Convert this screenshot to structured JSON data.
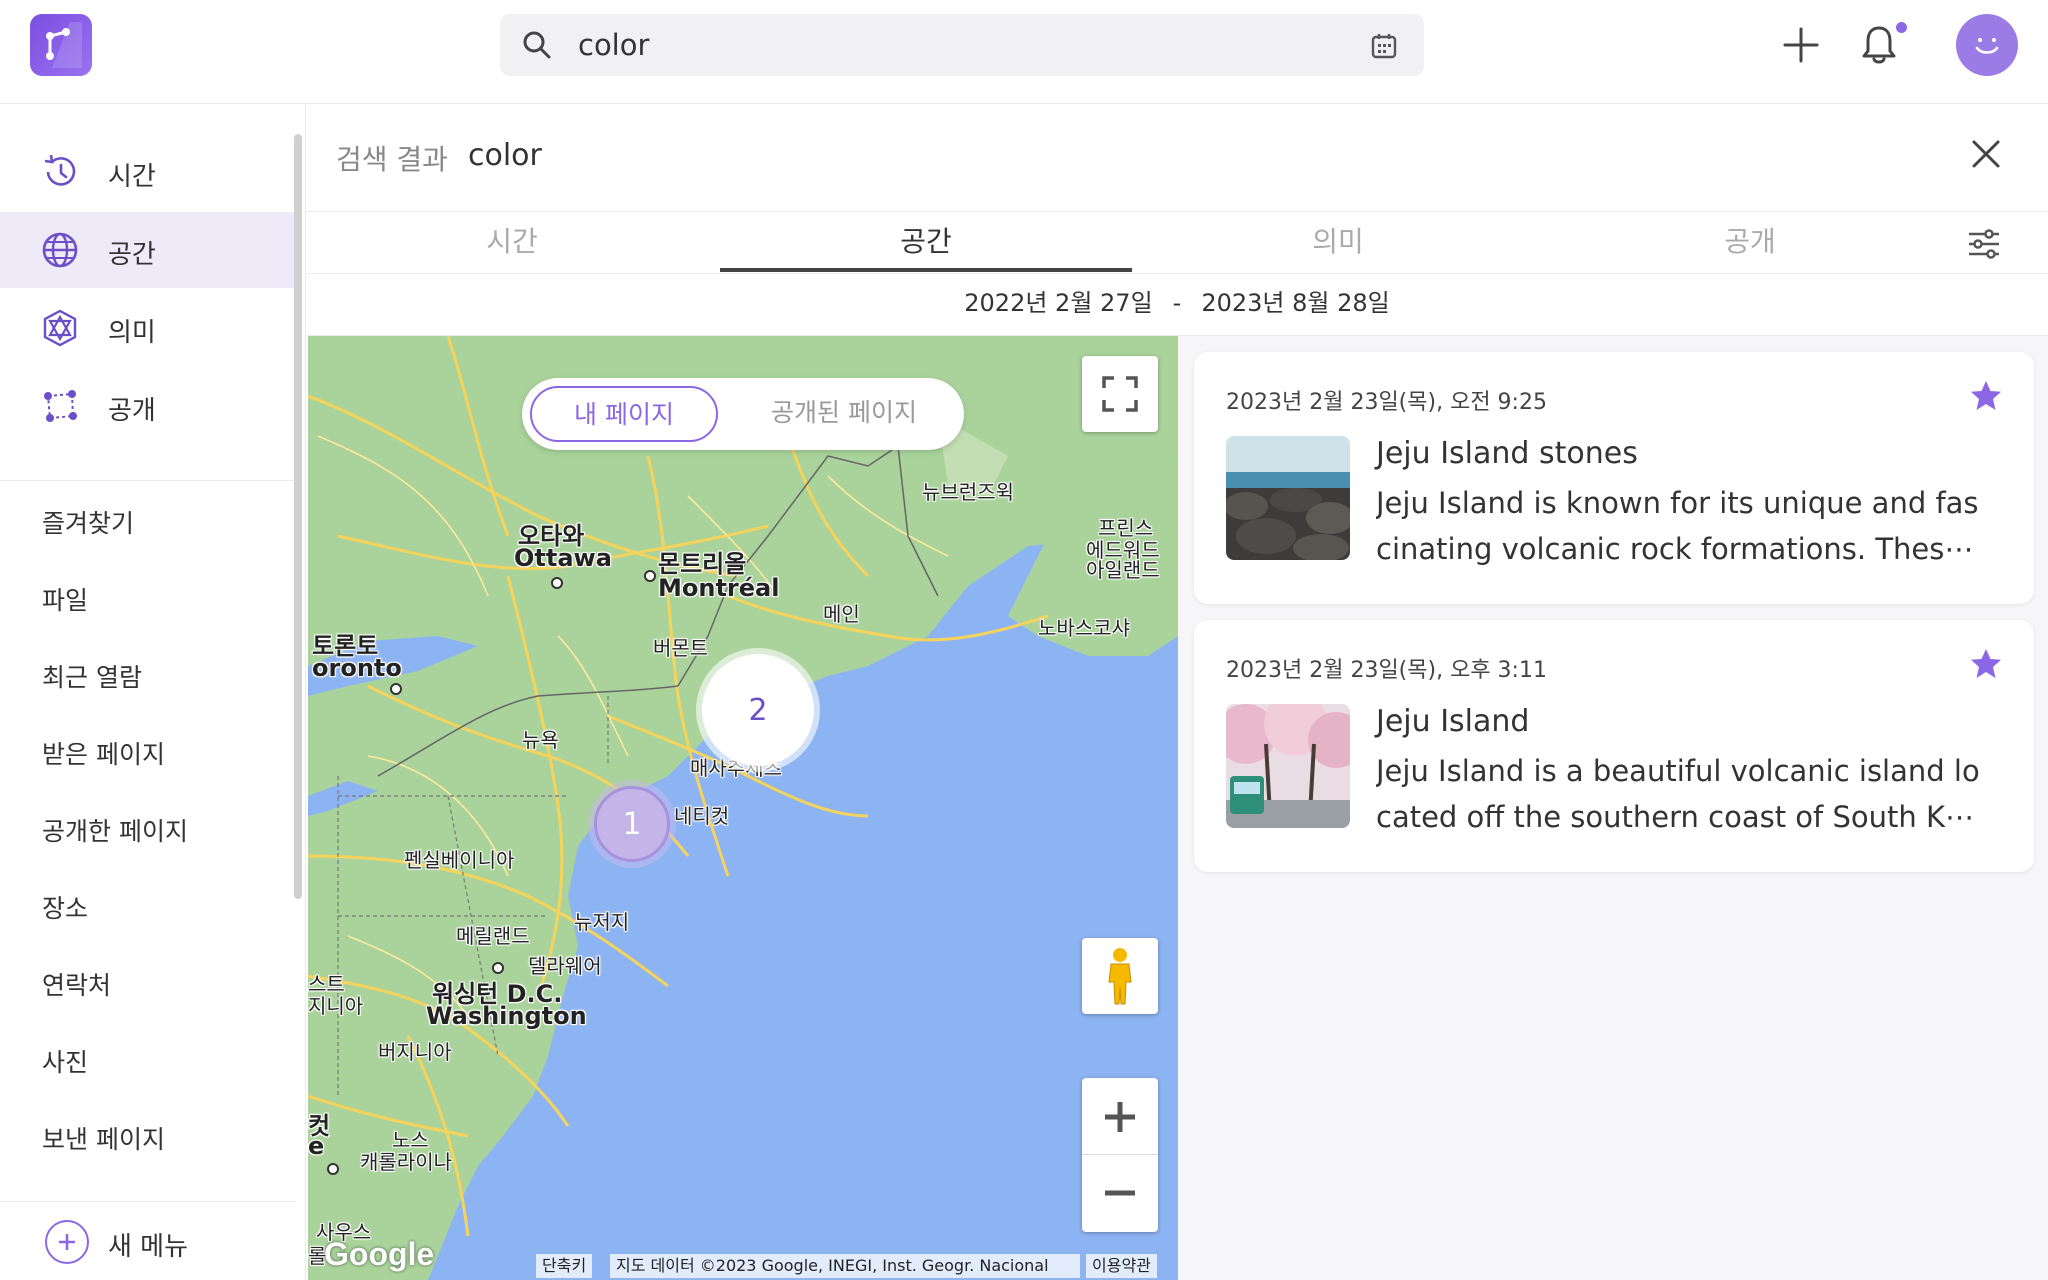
{
  "header": {
    "search": {
      "value": "color",
      "placeholder": ""
    },
    "icons": {
      "logo": "app-logo",
      "search": "search-icon",
      "calendar": "calendar-icon",
      "add": "plus-icon",
      "notifications": "bell-icon",
      "avatar": "smiley-avatar"
    }
  },
  "sidebar": {
    "nav": [
      {
        "label": "시간",
        "icon": "clock-history-icon"
      },
      {
        "label": "공간",
        "icon": "globe-icon"
      },
      {
        "label": "의미",
        "icon": "hexagon-network-icon"
      },
      {
        "label": "공개",
        "icon": "share-nodes-icon"
      }
    ],
    "active_index": 1,
    "menu": [
      "즐겨찾기",
      "파일",
      "최근 열람",
      "받은 페이지",
      "공개한 페이지",
      "장소",
      "연락처",
      "사진",
      "보낸 페이지"
    ],
    "new_menu": "새 메뉴"
  },
  "results": {
    "label": "검색 결과",
    "query": "color"
  },
  "tabs": {
    "items": [
      "시간",
      "공간",
      "의미",
      "공개"
    ],
    "active_index": 1
  },
  "date_range": {
    "start": "2022년 2월 27일",
    "separator": "-",
    "end": "2023년 8월 28일"
  },
  "map": {
    "toggle": {
      "mine": "내 페이지",
      "public": "공개된 페이지",
      "selected": "mine"
    },
    "clusters": [
      {
        "count": "2"
      },
      {
        "count": "1"
      }
    ],
    "labels": {
      "ottawa_ko": "오타와",
      "ottawa_en": "Ottawa",
      "montreal_ko": "몬트리올",
      "montreal_en": "Montréal",
      "toronto_ko": "토론토",
      "toronto_en": "oronto",
      "vermont": "버몬트",
      "maine": "메인",
      "newbrunswick": "뉴브런즈윅",
      "pei1": "프린스",
      "pei2": "에드워드",
      "pei3": "아일랜드",
      "novascotia": "노바스코샤",
      "newyork": "뉴욕",
      "mass": "매사추세츠",
      "conn": "네티컷",
      "penn": "펜실베이니아",
      "maryland": "메릴랜드",
      "newjersey": "뉴저지",
      "delaware": "델라웨어",
      "dc_ko": "워싱턴 D.C.",
      "dc_en": "Washington",
      "wv1": "스트",
      "wv2": "지니아",
      "virginia": "버지니아",
      "nc1": "노스",
      "nc2": "캐롤라이나",
      "sc": "사우스",
      "edge1": "컷",
      "edge2": "e",
      "edge3": "롤"
    },
    "attribution": {
      "shortcuts": "단축키",
      "data": "지도 데이터 ©2023 Google, INEGI, Inst. Geogr. Nacional",
      "terms": "이용약관"
    },
    "google_logo": "Google"
  },
  "cards": [
    {
      "date": "2023년 2월 23일(목), 오전 9:25",
      "title": "Jeju Island stones",
      "desc_line1": "Jeju Island is known for its unique and fas",
      "desc_line2": "cinating volcanic rock formations. Thes⋯",
      "starred": true
    },
    {
      "date": "2023년 2월 23일(목), 오후 3:11",
      "title": "Jeju Island",
      "desc_line1": "Jeju Island is a beautiful volcanic island lo",
      "desc_line2": "cated off the southern coast of South K⋯",
      "starred": true
    }
  ],
  "colors": {
    "accent": "#8b67e6",
    "active_bg": "#eeeaf8",
    "map_water": "#8db4f2",
    "map_land": "#a9d39b",
    "road": "#f6d35a"
  }
}
